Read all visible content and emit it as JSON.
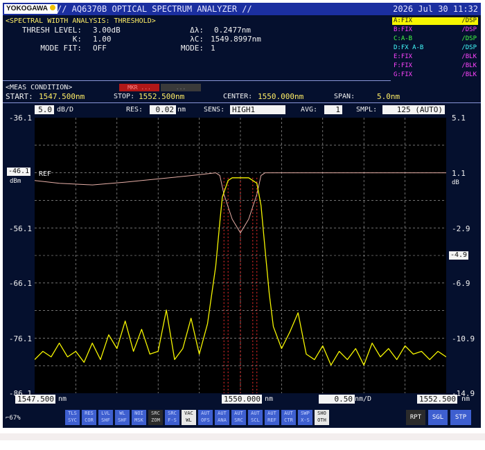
{
  "title_bar": {
    "brand": "YOKOGAWA",
    "title": "// AQ6370B OPTICAL SPECTRUM ANALYZER //",
    "datetime": "2026 Jul 30 11:32"
  },
  "analysis": {
    "header": "<SPECTRAL WIDTH ANALYSIS: THRESHOLD>",
    "thresh_label": "THRESH LEVEL:",
    "thresh_value": "3.00dB",
    "k_label": "K:",
    "k_value": "1.00",
    "mode_fit_label": "MODE FIT:",
    "mode_fit_value": "OFF",
    "delta_lambda_label": "Δλ:",
    "delta_lambda_value": "0.2477nm",
    "lambda_c_label": "λC:",
    "lambda_c_value": "1549.8997nm",
    "mode_label": "MODE:",
    "mode_value": "1"
  },
  "traces": [
    {
      "left": "A:FIX",
      "right": "/DSP",
      "color": "#f6f600",
      "selected": true
    },
    {
      "left": "B:FIX",
      "right": "/DSP",
      "color": "#ff44ff",
      "selected": false
    },
    {
      "left": "C:A-B",
      "right": "/DSP",
      "color": "#44ff44",
      "selected": false
    },
    {
      "left": "D:FX A-B",
      "right": "/DSP",
      "color": "#44ffff",
      "selected": false
    },
    {
      "left": "E:FIX",
      "right": "/BLK",
      "color": "#ff44ff",
      "selected": false
    },
    {
      "left": "F:FIX",
      "right": "/BLK",
      "color": "#ff44ff",
      "selected": false
    },
    {
      "left": "G:FIX",
      "right": "/BLK",
      "color": "#ff44ff",
      "selected": false
    }
  ],
  "meas": {
    "header": "<MEAS CONDITION>",
    "btn1": "MKR ...",
    "btn2": "...",
    "start_label": "START:",
    "start_value": "1547.500nm",
    "stop_label": "STOP:",
    "stop_value": "1552.500nm",
    "center_label": "CENTER:",
    "center_value": "1550.000nm",
    "span_label": "SPAN:",
    "span_value": "5.0nm"
  },
  "settings": {
    "scale_value": "5.0",
    "scale_unit": "dB/D",
    "res_label": "RES:",
    "res_value": "0.02",
    "res_unit": "nm",
    "sens_label": "SENS:",
    "sens_value": "HIGH1",
    "avg_label": "AVG:",
    "avg_value": "1",
    "smpl_label": "SMPL:",
    "smpl_value": "125 (AUTO)"
  },
  "y_left": {
    "ticks": [
      "-36.1",
      "-46.1",
      "-56.1",
      "-66.1",
      "-76.1",
      "-86.1"
    ],
    "ref_unit": "dBm",
    "ref_label": "REF"
  },
  "y_right": {
    "ticks": [
      "5.1",
      "1.1",
      "-2.9",
      "-6.9",
      "-10.9",
      "-14.9"
    ],
    "unit": "dB",
    "marker": "-4.9"
  },
  "x_bottom": {
    "start": "1547.500",
    "start_unit": "nm",
    "center": "1550.000",
    "center_unit": "nm",
    "per_div": "0.50",
    "per_div_unit": "nm/D",
    "stop": "1552.500",
    "stop_unit": "nm"
  },
  "status": {
    "memory": "67%"
  },
  "softkeys": [
    {
      "label": "TLS SYC",
      "style": "b"
    },
    {
      "label": "RES COR",
      "style": "b"
    },
    {
      "label": "LVL SHF",
      "style": "b"
    },
    {
      "label": "WL SHF",
      "style": "b"
    },
    {
      "label": "NOI MSK",
      "style": "b"
    },
    {
      "label": "SRC ZOM",
      "style": "d"
    },
    {
      "label": "SRC F-S",
      "style": "b"
    },
    {
      "label": "VAC WL",
      "style": "w"
    },
    {
      "label": "AUT OFS",
      "style": "b"
    },
    {
      "label": "AUT ANA",
      "style": "b"
    },
    {
      "label": "AUT SRC",
      "style": "b"
    },
    {
      "label": "AUT SCL",
      "style": "b"
    },
    {
      "label": "AUT REF",
      "style": "b"
    },
    {
      "label": "AUT CTR",
      "style": "b"
    },
    {
      "label": "SWP X-S",
      "style": "b"
    },
    {
      "label": "SHO OTH",
      "style": "w"
    }
  ],
  "sweep_buttons": [
    {
      "label": "RPT",
      "style": "d"
    },
    {
      "label": "SGL",
      "style": "b"
    },
    {
      "label": "STP",
      "style": "b"
    }
  ],
  "colors": {
    "screen_bg": "#05102e",
    "plot_bg": "#000000",
    "grid": "#b8b8b8",
    "trace_a": "#f6f600",
    "trace_ref": "#e8b0a8",
    "marker_lines": "#ff3030",
    "title_bar": "#1b2fa0"
  },
  "chart_data": {
    "type": "line",
    "xlabel": "nm",
    "ylabel": "dBm",
    "xlim": [
      1547.5,
      1552.5
    ],
    "ylim": [
      -86.1,
      -36.1
    ],
    "y2lim": [
      -14.9,
      5.1
    ],
    "grid": true,
    "series": [
      {
        "name": "A:FIX",
        "x": [
          1547.5,
          1547.6,
          1547.7,
          1547.8,
          1547.9,
          1548.0,
          1548.1,
          1548.2,
          1548.3,
          1548.4,
          1548.5,
          1548.6,
          1548.7,
          1548.8,
          1548.9,
          1549.0,
          1549.1,
          1549.2,
          1549.3,
          1549.4,
          1549.5,
          1549.6,
          1549.7,
          1549.75,
          1549.78,
          1549.85,
          1549.9,
          1549.95,
          1550.0,
          1550.05,
          1550.1,
          1550.15,
          1550.2,
          1550.25,
          1550.3,
          1550.35,
          1550.4,
          1550.5,
          1550.6,
          1550.7,
          1550.8,
          1550.9,
          1551.0,
          1551.1,
          1551.2,
          1551.3,
          1551.4,
          1551.5,
          1551.6,
          1551.7,
          1551.8,
          1551.9,
          1552.0,
          1552.1,
          1552.2,
          1552.3,
          1552.4,
          1552.5
        ],
        "y": [
          -80,
          -78.5,
          -79.5,
          -77,
          -79.5,
          -78.5,
          -80.5,
          -77,
          -80,
          -75.5,
          -78,
          -73,
          -78.5,
          -74.5,
          -79,
          -78.5,
          -71,
          -80,
          -78,
          -72.5,
          -79,
          -73.5,
          -63,
          -55,
          -50.5,
          -47.5,
          -47,
          -47,
          -47,
          -47,
          -47,
          -47.5,
          -48,
          -52,
          -60,
          -68,
          -74,
          -78,
          -75,
          -71.5,
          -79,
          -80,
          -77.5,
          -81,
          -78.5,
          -80,
          -78,
          -81,
          -77,
          -79.5,
          -78,
          -80,
          -77.5,
          -79,
          -78.5,
          -80,
          -78.5,
          -79.5
        ]
      },
      {
        "name": "B:FIX",
        "x": [
          1547.5,
          1547.8,
          1548.2,
          1548.6,
          1549.0,
          1549.4,
          1549.7,
          1549.75,
          1549.8,
          1549.9,
          1550.0,
          1550.1,
          1550.2,
          1550.25,
          1550.3,
          1550.6,
          1551.0,
          1551.5,
          1552.0,
          1552.5
        ],
        "y": [
          -47.5,
          -48,
          -48.3,
          -47.8,
          -47.2,
          -46.6,
          -46.1,
          -46.6,
          -50,
          -54.5,
          -57,
          -54.5,
          -50,
          -46.6,
          -46.1,
          -46.1,
          -46.1,
          -46.1,
          -46.1,
          -46.1
        ]
      }
    ],
    "markers_x": [
      1549.85,
      1550.15
    ],
    "annotations": [
      "REF"
    ]
  }
}
